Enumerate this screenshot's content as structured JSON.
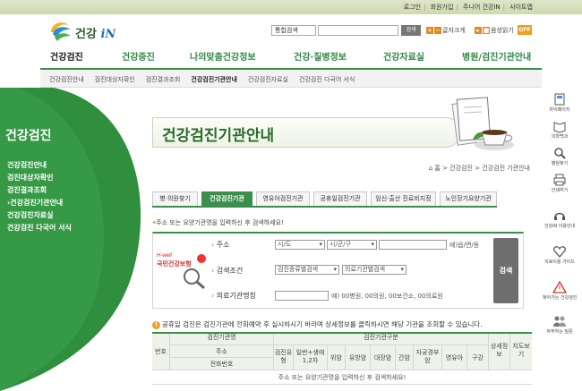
{
  "util_links": [
    "로그인",
    "회원가입",
    "주니어 건강iN",
    "사이트맵"
  ],
  "brand": {
    "name_ko": "건강",
    "name_in": "iN"
  },
  "search": {
    "select_value": "통합검색",
    "placeholder": "",
    "button": "검색"
  },
  "font_control": {
    "larger": "글자크게",
    "smaller": "음성읽기",
    "off": "OFF"
  },
  "gnb": [
    "건강검진",
    "건강증진",
    "나의맞춤건강정보",
    "건강·질병정보",
    "건강자료실",
    "병원/검진기관안내"
  ],
  "lnb": [
    "건강검진안내",
    "검진대상자확인",
    "검진결과조회",
    "건강검진기관안내",
    "건강검진자료실",
    "건강검진 다국어 서식"
  ],
  "sidebar": {
    "title": "건강검진",
    "items": [
      "건강검진안내",
      "검진대상자확인",
      "검진결과조회",
      "건강검진기관안내",
      "건강검진자료실",
      "건강검진 다국어 서식"
    ]
  },
  "page_title": "건강검진기관안내",
  "breadcrumb": "홈 > 건강검진 > 건강검진 기관안내",
  "tabs": [
    "병·의원찾기",
    "건강검진기관",
    "영유아검진기관",
    "공휴일검진기관",
    "임신·출산 진료비지정",
    "노인장기요양기관"
  ],
  "hint": "주소 또는 요양기관명을 입력하신 후 검색하세요!",
  "form": {
    "logo_text": "국민건강보험",
    "logo_sub": "H-well",
    "address_label": "주소",
    "sido": "시/도",
    "sigungu": "시/군/구",
    "address_note": "예)읍/면/동",
    "condition_label": "검색조건",
    "condition_1": "검진종류별검색",
    "condition_2": "의료기관별검색",
    "name_label": "의료기관명칭",
    "name_note": "예) 00병원, 00의원, 00보건소, 00의료원",
    "search_button": "검색"
  },
  "notice": "공휴일 검진은 검진기관에 전화예약 후 실시하시기 바라며 상세정보를 클릭하시면 해당 기관을 조회할 수 있습니다.",
  "table": {
    "col_no": "번호",
    "group_inst": "검진기관명",
    "inst_name": "주소",
    "inst_tel": "전화번호",
    "group_type": "검진기관구분",
    "types": [
      "검진유형",
      "일반+생애1,2차",
      "위암",
      "유방암",
      "대장암",
      "간암",
      "자궁경부암",
      "영유아",
      "구강"
    ],
    "detail": "상세정보",
    "map": "지도보기",
    "empty": "주소 또는 요양기관명을 입력하신 후 검색하세요!"
  },
  "quick_menu": [
    "마이페이지",
    "의학백과",
    "병원찾기",
    "인쇄하기",
    "건강iN 이용안내",
    "의료이용 가이드",
    "찾아가는 건강검진",
    "자주하는 질문"
  ]
}
